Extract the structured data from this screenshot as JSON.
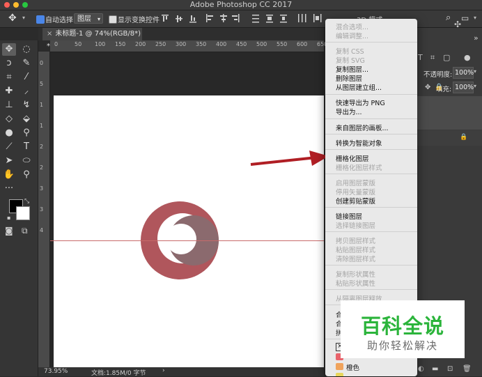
{
  "window": {
    "title": "Adobe Photoshop CC 2017"
  },
  "options_bar": {
    "auto_select_label": "自动选择:",
    "auto_select_value": "图层",
    "show_transform_label": "显示变换控件",
    "mode_3d_label": "3D 模式:"
  },
  "document": {
    "tab_title": "未标题-1 @ 74%(RGB/8*) *"
  },
  "ruler": {
    "h_ticks": [
      "0",
      "50",
      "100",
      "150",
      "200",
      "250",
      "300",
      "350",
      "400",
      "450",
      "500",
      "550",
      "600",
      "650"
    ],
    "v_ticks": [
      "0",
      "5",
      "1",
      "1",
      "2",
      "2",
      "3",
      "3",
      "4"
    ]
  },
  "status": {
    "zoom": "73.95%",
    "doc_info": "文档:1.85M/0 字节"
  },
  "right_panel": {
    "opacity_label": "不透明度:",
    "opacity_value": "100%",
    "fill_label": "填充:",
    "fill_value": "100%"
  },
  "context_menu": {
    "items": [
      {
        "label": "混合选项...",
        "enabled": false
      },
      {
        "label": "编辑调整...",
        "enabled": false
      },
      {
        "label": "复制 CSS",
        "enabled": false
      },
      {
        "label": "复制 SVG",
        "enabled": false
      },
      {
        "label": "复制图层...",
        "enabled": true
      },
      {
        "label": "删除图层",
        "enabled": true
      },
      {
        "label": "从图层建立组...",
        "enabled": true
      },
      {
        "label": "快速导出为 PNG",
        "enabled": true
      },
      {
        "label": "导出为...",
        "enabled": true
      },
      {
        "label": "来自图层的画板...",
        "enabled": true
      },
      {
        "label": "转换为智能对象",
        "enabled": true
      },
      {
        "label": "栅格化图层",
        "enabled": true
      },
      {
        "label": "栅格化图层样式",
        "enabled": false
      },
      {
        "label": "启用图层蒙版",
        "enabled": false
      },
      {
        "label": "停用矢量蒙版",
        "enabled": false
      },
      {
        "label": "创建剪贴蒙版",
        "enabled": true
      },
      {
        "label": "链接图层",
        "enabled": true
      },
      {
        "label": "选择链接图层",
        "enabled": false
      },
      {
        "label": "拷贝图层样式",
        "enabled": false
      },
      {
        "label": "粘贴图层样式",
        "enabled": false
      },
      {
        "label": "清除图层样式",
        "enabled": false
      },
      {
        "label": "复制形状属性",
        "enabled": false
      },
      {
        "label": "粘贴形状属性",
        "enabled": false
      },
      {
        "label": "从隔离图层释放",
        "enabled": false
      },
      {
        "label": "合并",
        "enabled": true
      },
      {
        "label": "合并",
        "enabled": true
      },
      {
        "label": "拼合",
        "enabled": true
      },
      {
        "label": "橙色",
        "enabled": true
      }
    ]
  },
  "watermark": {
    "main": "百科全说",
    "sub": "助你轻松解决"
  },
  "colors": {
    "swatch_red": "#e8636b",
    "swatch_orange": "#f0a35c",
    "swatch_yellow": "#e8d65c",
    "arrow": "#b01e24",
    "shape": "#b0565c"
  }
}
